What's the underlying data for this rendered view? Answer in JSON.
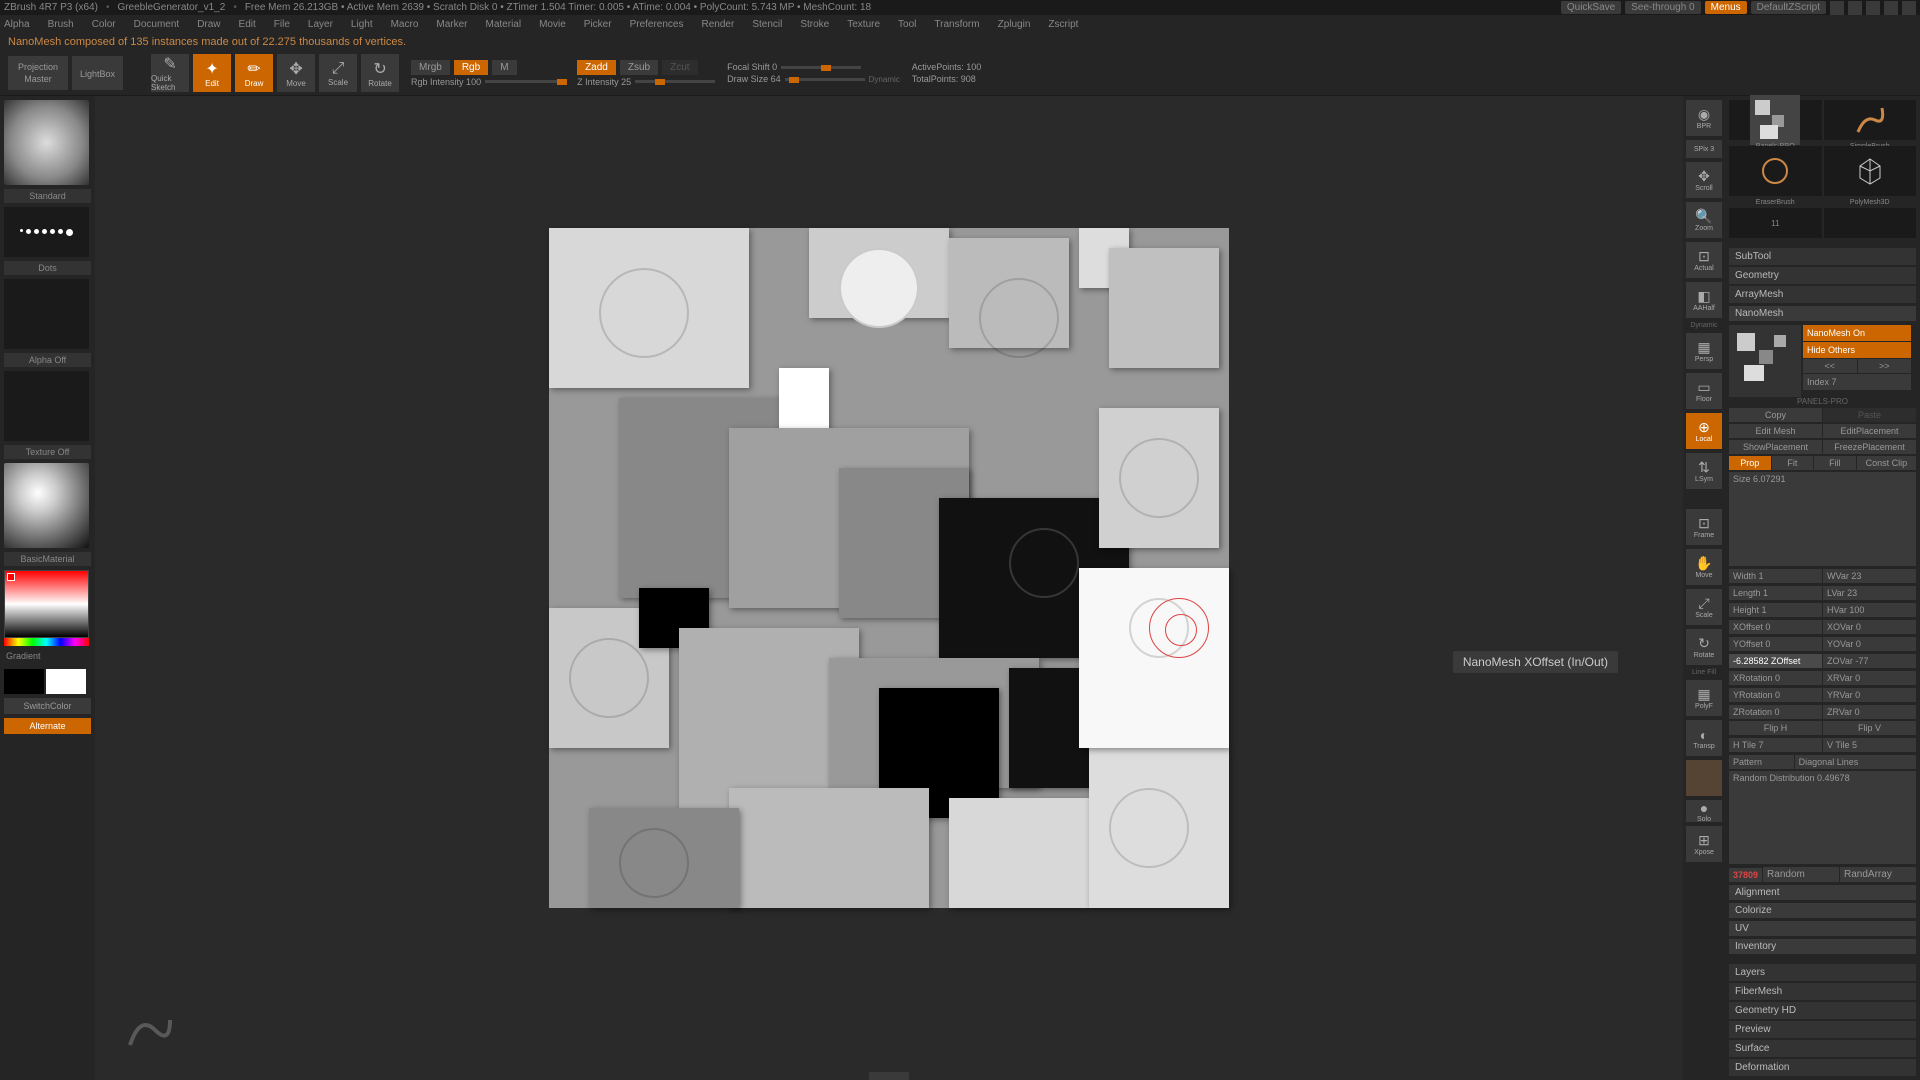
{
  "titlebar": {
    "app": "ZBrush 4R7 P3 (x64)",
    "project": "GreebleGenerator_v1_2",
    "stats": "Free Mem 26.213GB • Active Mem 2639 • Scratch Disk 0 • ZTimer 1.504 Timer: 0.005 • ATime: 0.004 • PolyCount: 5.743 MP • MeshCount: 18",
    "quicksave": "QuickSave",
    "seethrough": "See-through  0",
    "menus": "Menus",
    "script": "DefaultZScript"
  },
  "menubar": [
    "Alpha",
    "Brush",
    "Color",
    "Document",
    "Draw",
    "Edit",
    "File",
    "Layer",
    "Light",
    "Macro",
    "Marker",
    "Material",
    "Movie",
    "Picker",
    "Preferences",
    "Render",
    "Stencil",
    "Stroke",
    "Texture",
    "Tool",
    "Transform",
    "Zplugin",
    "Zscript"
  ],
  "status": "NanoMesh composed of 135 instances made out of 22.275 thousands of vertices.",
  "toolbar": {
    "projection": "Projection\nMaster",
    "lightbox": "LightBox",
    "quicksketch": "Quick\nSketch",
    "edit": "Edit",
    "draw": "Draw",
    "move": "Move",
    "scale": "Scale",
    "rotate": "Rotate",
    "mrgb": "Mrgb",
    "rgb": "Rgb",
    "m": "M",
    "rgbint": "Rgb Intensity 100",
    "zadd": "Zadd",
    "zsub": "Zsub",
    "zcut": "Zcut",
    "zint": "Z Intensity 25",
    "focal": "Focal Shift 0",
    "drawsize": "Draw Size 64",
    "dynamic": "Dynamic",
    "active": "ActivePoints: 100",
    "total": "TotalPoints: 908"
  },
  "left": {
    "brush": "Standard",
    "stroke": "Dots",
    "alpha": "Alpha Off",
    "texture": "Texture Off",
    "material": "BasicMaterial",
    "gradient": "Gradient",
    "switchcolor": "SwitchColor",
    "alternate": "Alternate"
  },
  "rightstrip": {
    "bpr": "BPR",
    "spix": "SPix 3",
    "scroll": "Scroll",
    "zoom": "Zoom",
    "actual": "Actual",
    "aahalf": "AAHalf",
    "persp": "Persp",
    "floor": "Floor",
    "local": "Local",
    "lsym": "LSym",
    "frame": "Frame",
    "move": "Move",
    "scale": "Scale",
    "rotate": "Rotate",
    "linefill": "Line Fill",
    "polyf": "PolyF",
    "transp": "Transp",
    "solo": "Solo",
    "xpose": "Xpose"
  },
  "tooltip": "NanoMesh XOffset (In/Out)",
  "panel": {
    "tools": {
      "simple": "SimpleBrush",
      "poly": "PolyMesh3D",
      "eraser": "EraserBrush",
      "panels": "Panels-PRO"
    },
    "subtool": "SubTool",
    "geometry": "Geometry",
    "arraymesh": "ArrayMesh",
    "nanomesh": "NanoMesh",
    "nanomesh_on": "NanoMesh On",
    "hide_others": "Hide Others",
    "prev": "<<",
    "next": ">>",
    "index": "Index 7",
    "copy": "Copy",
    "paste": "Paste",
    "editmesh": "Edit Mesh",
    "editplacement": "EditPlacement",
    "showplacement": "ShowPlacement",
    "freezeplacement": "FreezePlacement",
    "prop": "Prop",
    "fit": "Fit",
    "fill": "Fill",
    "constclip": "Const Clip",
    "size": "Size 6.07291",
    "width": "Width 1",
    "wvar": "WVar 23",
    "length": "Length 1",
    "lvar": "LVar 23",
    "height": "Height 1",
    "hvar": "HVar 100",
    "xoffset": "XOffset 0",
    "xovar": "XOVar 0",
    "yoffset": "YOffset 0",
    "yovar": "YOVar 0",
    "zoffset": "-6.28582 ZOffset",
    "zovar": "ZOVar -77",
    "xrot": "XRotation 0",
    "xrvar": "XRVar 0",
    "yrot": "YRotation 0",
    "yrvar": "YRVar 0",
    "zrot": "ZRotation 0",
    "zrvar": "ZRVar 0",
    "fliph": "Flip H",
    "flipv": "Flip V",
    "htile": "H Tile 7",
    "vtile": "V Tile 5",
    "pattern": "Pattern",
    "pattern_val": "Diagonal Lines",
    "randdist": "Random Distribution 0.49678",
    "seed": "37809",
    "random": "Random",
    "randarray": "RandArray",
    "alignment": "Alignment",
    "colorize": "Colorize",
    "uv": "UV",
    "inventory": "Inventory",
    "layers": "Layers",
    "fibermesh": "FiberMesh",
    "geometryhd": "Geometry HD",
    "preview": "Preview",
    "surface": "Surface",
    "deformation": "Deformation",
    "panels_pro": "PANELS-PRO"
  }
}
